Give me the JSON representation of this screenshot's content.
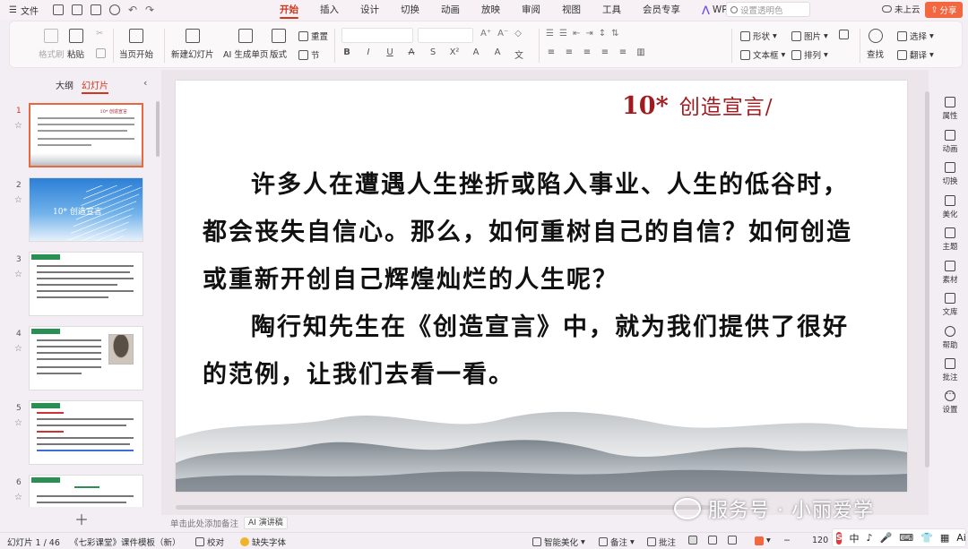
{
  "menu": {
    "file_label": "文件",
    "tabs": [
      {
        "label": "开始",
        "active": true
      },
      {
        "label": "插入"
      },
      {
        "label": "设计"
      },
      {
        "label": "切换"
      },
      {
        "label": "动画"
      },
      {
        "label": "放映"
      },
      {
        "label": "审阅"
      },
      {
        "label": "视图"
      },
      {
        "label": "工具"
      },
      {
        "label": "会员专享"
      },
      {
        "label": "WPS AI"
      }
    ],
    "search_placeholder": "设置透明色",
    "cloud_label": "未上云",
    "share_label": "分享"
  },
  "ribbon": {
    "format_painter": "格式刷",
    "paste": "粘贴",
    "play_current": "当页开始",
    "new_slide": "新建幻灯片",
    "ai_generate": "AI 生成单页",
    "layout": "版式",
    "reset": "重置",
    "section": "节",
    "shape": "形状",
    "textbox": "文本框",
    "picture": "图片",
    "arrange": "排列",
    "find": "查找",
    "select": "选择",
    "translate": "翻译"
  },
  "left_panel": {
    "tab_outline": "大纲",
    "tab_slides": "幻灯片",
    "slides": [
      {
        "num": "1",
        "active": true
      },
      {
        "num": "2"
      },
      {
        "num": "3"
      },
      {
        "num": "4"
      },
      {
        "num": "5"
      },
      {
        "num": "6"
      }
    ],
    "thumb2_title": "10*  创造宣言"
  },
  "slide": {
    "title_num": "10*",
    "title_name": "创造宣言/",
    "paragraph1": "许多人在遭遇人生挫折或陷入事业、人生的低谷时，都会丧失自信心。那么，如何重树自己的自信？如何创造或重新开创自己辉煌灿烂的人生呢？",
    "paragraph2": "陶行知先生在《创造宣言》中，就为我们提供了很好的范例，让我们去看一看。"
  },
  "notes": {
    "placeholder": "单击此处添加备注",
    "ai_button": "AI 演讲稿"
  },
  "right_sidebar": [
    {
      "label": "属性",
      "icon": "sliders-icon"
    },
    {
      "label": "动画",
      "icon": "star-icon"
    },
    {
      "label": "切换",
      "icon": "transition-icon"
    },
    {
      "label": "美化",
      "icon": "brush-icon"
    },
    {
      "label": "主题",
      "icon": "shirt-icon"
    },
    {
      "label": "素材",
      "icon": "material-icon"
    },
    {
      "label": "文库",
      "icon": "library-icon"
    },
    {
      "label": "帮助",
      "icon": "help-icon"
    },
    {
      "label": "批注",
      "icon": "comment-icon"
    },
    {
      "label": "设置",
      "icon": "gear-icon"
    }
  ],
  "status": {
    "slide_count": "幻灯片 1 / 46",
    "template": "《七彩课堂》课件模板（新）",
    "proofread": "校对",
    "missing_font": "缺失字体",
    "beautify": "智能美化",
    "notes": "备注",
    "comments": "批注",
    "zoom": "120"
  },
  "ime": {
    "lang": "中",
    "ai": "Ai"
  },
  "watermark": "服务号 · 小丽爱学"
}
